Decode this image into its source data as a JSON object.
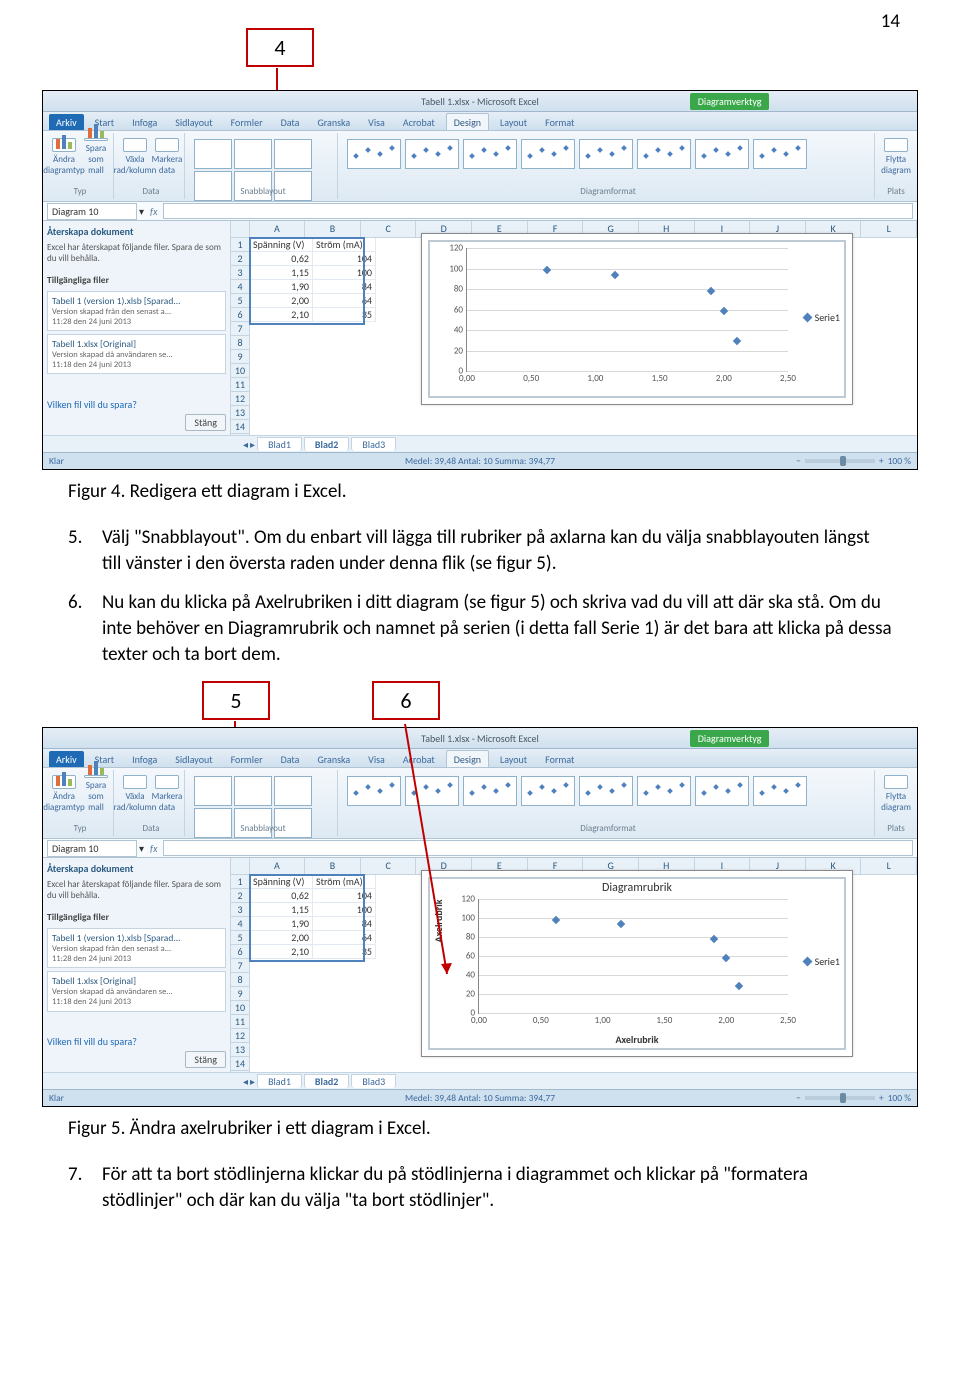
{
  "page_number": "14",
  "callouts": {
    "c4": "4",
    "c5": "5",
    "c6": "6"
  },
  "captions": {
    "fig4": "Figur 4. Redigera ett diagram i Excel.",
    "fig5": "Figur 5. Ändra axelrubriker i ett diagram i Excel."
  },
  "steps": {
    "s5": "Välj \"Snabblayout\". Om du enbart vill lägga till rubriker på axlarna kan du välja snabblayouten längst till vänster i den översta raden under denna flik (se figur 5).",
    "s6": "Nu kan du klicka på Axelrubriken i ditt diagram (se figur 5) och skriva vad du vill att där ska stå. Om du inte behöver en Diagramrubrik och namnet på serien (i detta fall Serie 1) är det bara att klicka på dessa texter och ta bort dem.",
    "s7": "För att ta bort stödlinjerna klickar du på stödlinjerna i diagrammet och klickar på \"formatera stödlinjer\" och där kan du välja \"ta bort stödlinjer\".",
    "n5": "5.",
    "n6": "6.",
    "n7": "7."
  },
  "excel": {
    "title": "Tabell 1.xlsx - Microsoft Excel",
    "context": "Diagramverktyg",
    "tabs": [
      "Arkiv",
      "Start",
      "Infoga",
      "Sidlayout",
      "Formler",
      "Data",
      "Granska",
      "Visa",
      "Acrobat",
      "Design",
      "Layout",
      "Format"
    ],
    "active_tab": "Design",
    "ribbon_groups": {
      "typ": "Typ",
      "data": "Data",
      "snabb": "Snabblayout",
      "fmt": "Diagramformat",
      "plats": "Plats"
    },
    "ribbon_btns": {
      "andra": "Ändra\ndiagramtyp",
      "spara": "Spara\nsom mall",
      "vaxla": "Växla\nrad/kolumn",
      "markera": "Markera\ndata",
      "flytta": "Flytta\ndiagram"
    },
    "namebox": "Diagram 10",
    "fx": "fx",
    "docpane": {
      "hd": "Återskapa dokument",
      "desc": "Excel har återskapat följande filer. Spara de som du vill behålla.",
      "sec": "Tillgängliga filer",
      "f1": {
        "fn": "Tabell 1 (version 1).xlsb [Sparad...",
        "d1": "Version skapad från den senast a...",
        "d2": "11:28 den 24 juni 2013"
      },
      "f2": {
        "fn": "Tabell 1.xlsx [Original]",
        "d1": "Version skapad då användaren se...",
        "d2": "11:18 den 24 juni 2013"
      },
      "q": "Vilken fil vill du spara?",
      "close": "Stäng"
    },
    "columns": [
      "A",
      "B",
      "C",
      "D",
      "E",
      "F",
      "G",
      "H",
      "I",
      "J",
      "K",
      "L"
    ],
    "headers": [
      "Spänning (V)",
      "Ström (mA)"
    ],
    "rows": [
      [
        "0,62",
        "104"
      ],
      [
        "1,15",
        "100"
      ],
      [
        "1,90",
        "84"
      ],
      [
        "2,00",
        "64"
      ],
      [
        "2,10",
        "35"
      ]
    ],
    "legend": "Serie1",
    "status_left": "Klar",
    "status_mid": "Medel: 39,48   Antal: 10   Summa: 394,77",
    "zoom": "100 %",
    "sheets": [
      "Blad1",
      "Blad2",
      "Blad3"
    ],
    "chart2": {
      "title": "Diagramrubrik",
      "ylabel": "Axelrubrik",
      "xlabel": "Axelrubrik"
    }
  },
  "chart_data": {
    "type": "scatter",
    "x": [
      0.62,
      1.15,
      1.9,
      2.0,
      2.1
    ],
    "y": [
      104,
      100,
      84,
      64,
      35
    ],
    "xlim": [
      0,
      2.5
    ],
    "ylim": [
      0,
      120
    ],
    "xticks": [
      "0,00",
      "0,50",
      "1,00",
      "1,50",
      "2,00",
      "2,50"
    ],
    "yticks": [
      "0",
      "20",
      "40",
      "60",
      "80",
      "100",
      "120"
    ],
    "legend": "Serie1"
  }
}
